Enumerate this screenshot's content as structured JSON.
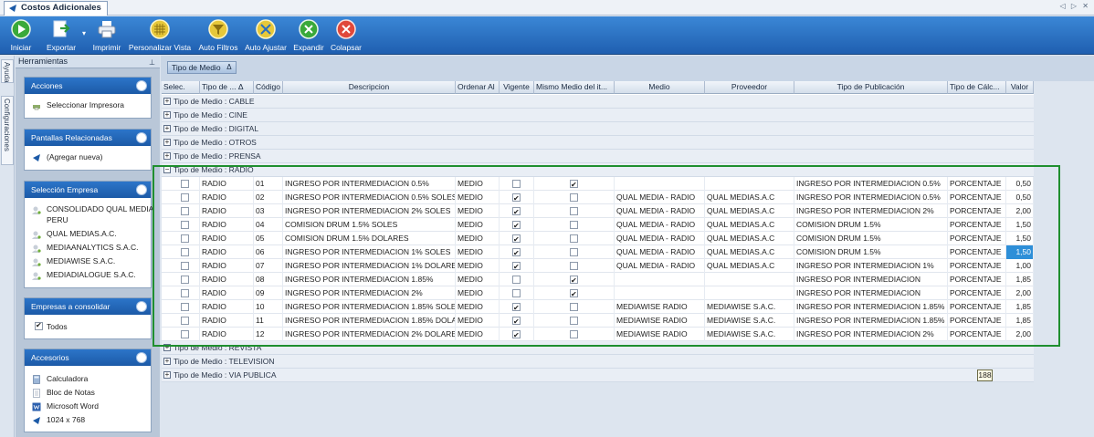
{
  "window": {
    "tab_title": "Costos Adicionales",
    "nav_arrows": "◁ ▷ ✕"
  },
  "toolbar": {
    "buttons": [
      {
        "label": "Iniciar",
        "icon": "play-icon"
      },
      {
        "label": "Exportar",
        "icon": "export-icon"
      },
      {
        "label": "Imprimir",
        "icon": "printer-icon"
      },
      {
        "label": "Personalizar Vista",
        "icon": "grid-view-icon"
      },
      {
        "label": "Auto Filtros",
        "icon": "filter-icon"
      },
      {
        "label": "Auto Ajustar",
        "icon": "auto-fit-icon"
      },
      {
        "label": "Expandir",
        "icon": "expand-icon"
      },
      {
        "label": "Colapsar",
        "icon": "collapse-icon"
      }
    ],
    "export_dropdown": "▾"
  },
  "side_tabs": {
    "ayuda": "Ayuda",
    "configuraciones": "Configuraciones"
  },
  "sidebar": {
    "title": "Herramientas",
    "pin": "⊥",
    "acciones": {
      "title": "Acciones",
      "items": [
        "Seleccionar Impresora"
      ]
    },
    "pantallas": {
      "title": "Pantallas Relacionadas",
      "items": [
        "(Agregar nueva)"
      ]
    },
    "empresa": {
      "title": "Selección Empresa",
      "items": [
        "CONSOLIDADO QUAL MEDIA",
        "PERU",
        "QUAL MEDIAS.A.C.",
        "MEDIAANALYTICS S.A.C.",
        "MEDIAWISE S.A.C.",
        "MEDIADIALOGUE S.A.C."
      ]
    },
    "consolidar": {
      "title": "Empresas a consolidar",
      "items": [
        "Todos"
      ]
    },
    "accesorios": {
      "title": "Accesorios",
      "items": [
        "Calculadora",
        "Bloc de Notas",
        "Microsoft Word",
        "1024 x 768"
      ]
    }
  },
  "grid": {
    "group_chip": "Tipo de Medio",
    "sort_glyph": "Δ",
    "columns": [
      "Selec.",
      "Tipo de ... Δ",
      "Código",
      "Descripcion",
      "Ordenar Al",
      "Vigente",
      "Mismo Medio del it...",
      "Medio",
      "Proveedor",
      "Tipo de Publicación",
      "Tipo de Cálc...",
      "Valor"
    ],
    "groups_before": [
      "Tipo de Medio : CABLE",
      "Tipo de Medio : CINE",
      "Tipo de Medio : DIGITAL",
      "Tipo de Medio : OTROS",
      "Tipo de Medio : PRENSA"
    ],
    "expanded_group": "Tipo de Medio : RADIO",
    "rows": [
      {
        "tipo": "RADIO",
        "codigo": "01",
        "desc": "INGRESO POR INTERMEDIACION 0.5%",
        "ordenar": "MEDIO",
        "vigente": false,
        "mismo": true,
        "medio": "",
        "proveedor": "",
        "publicacion": "INGRESO POR INTERMEDIACION 0.5%",
        "calculo": "PORCENTAJE",
        "valor": "0,50"
      },
      {
        "tipo": "RADIO",
        "codigo": "02",
        "desc": "INGRESO POR INTERMEDIACION 0.5% SOLES",
        "ordenar": "MEDIO",
        "vigente": true,
        "mismo": false,
        "medio": "QUAL MEDIA - RADIO",
        "proveedor": "QUAL MEDIAS.A.C",
        "publicacion": "INGRESO POR INTERMEDIACION 0.5%",
        "calculo": "PORCENTAJE",
        "valor": "0,50"
      },
      {
        "tipo": "RADIO",
        "codigo": "03",
        "desc": "INGRESO POR INTERMEDIACION 2% SOLES",
        "ordenar": "MEDIO",
        "vigente": true,
        "mismo": false,
        "medio": "QUAL MEDIA - RADIO",
        "proveedor": "QUAL MEDIAS.A.C",
        "publicacion": "INGRESO POR INTERMEDIACION 2%",
        "calculo": "PORCENTAJE",
        "valor": "2,00"
      },
      {
        "tipo": "RADIO",
        "codigo": "04",
        "desc": "COMISION DRUM 1.5% SOLES",
        "ordenar": "MEDIO",
        "vigente": true,
        "mismo": false,
        "medio": "QUAL MEDIA - RADIO",
        "proveedor": "QUAL MEDIAS.A.C",
        "publicacion": "COMISION DRUM 1.5%",
        "calculo": "PORCENTAJE",
        "valor": "1,50"
      },
      {
        "tipo": "RADIO",
        "codigo": "05",
        "desc": "COMISION DRUM 1.5% DOLARES",
        "ordenar": "MEDIO",
        "vigente": true,
        "mismo": false,
        "medio": "QUAL MEDIA - RADIO",
        "proveedor": "QUAL MEDIAS.A.C",
        "publicacion": "COMISION DRUM 1.5%",
        "calculo": "PORCENTAJE",
        "valor": "1,50"
      },
      {
        "tipo": "RADIO",
        "codigo": "06",
        "desc": "INGRESO POR INTERMEDIACION 1% SOLES",
        "ordenar": "MEDIO",
        "vigente": true,
        "mismo": false,
        "medio": "QUAL MEDIA - RADIO",
        "proveedor": "QUAL MEDIAS.A.C",
        "publicacion": "COMISION DRUM 1.5%",
        "calculo": "PORCENTAJE",
        "valor": "1,50",
        "selected_value": true
      },
      {
        "tipo": "RADIO",
        "codigo": "07",
        "desc": "INGRESO POR INTERMEDIACION 1% DOLARES",
        "ordenar": "MEDIO",
        "vigente": true,
        "mismo": false,
        "medio": "QUAL MEDIA - RADIO",
        "proveedor": "QUAL MEDIAS.A.C",
        "publicacion": "INGRESO POR INTERMEDIACION 1%",
        "calculo": "PORCENTAJE",
        "valor": "1,00"
      },
      {
        "tipo": "RADIO",
        "codigo": "08",
        "desc": "INGRESO POR INTERMEDIACION 1.85%",
        "ordenar": "MEDIO",
        "vigente": false,
        "mismo": true,
        "medio": "",
        "proveedor": "",
        "publicacion": "INGRESO POR INTERMEDIACION",
        "calculo": "PORCENTAJE",
        "valor": "1,85"
      },
      {
        "tipo": "RADIO",
        "codigo": "09",
        "desc": "INGRESO POR INTERMEDIACION 2%",
        "ordenar": "MEDIO",
        "vigente": false,
        "mismo": true,
        "medio": "",
        "proveedor": "",
        "publicacion": "INGRESO POR INTERMEDIACION",
        "calculo": "PORCENTAJE",
        "valor": "2,00"
      },
      {
        "tipo": "RADIO",
        "codigo": "10",
        "desc": "INGRESO POR INTERMEDIACION 1.85% SOLES",
        "ordenar": "MEDIO",
        "vigente": true,
        "mismo": false,
        "medio": "MEDIAWISE RADIO",
        "proveedor": "MEDIAWISE S.A.C.",
        "publicacion": "INGRESO POR INTERMEDIACION 1.85%",
        "calculo": "PORCENTAJE",
        "valor": "1,85"
      },
      {
        "tipo": "RADIO",
        "codigo": "11",
        "desc": "INGRESO POR INTERMEDIACION 1.85% DOLARES",
        "ordenar": "MEDIO",
        "vigente": true,
        "mismo": false,
        "medio": "MEDIAWISE RADIO",
        "proveedor": "MEDIAWISE S.A.C.",
        "publicacion": "INGRESO POR INTERMEDIACION 1.85%",
        "calculo": "PORCENTAJE",
        "valor": "1,85"
      },
      {
        "tipo": "RADIO",
        "codigo": "12",
        "desc": "INGRESO POR INTERMEDIACION 2% DOLARES",
        "ordenar": "MEDIO",
        "vigente": true,
        "mismo": false,
        "medio": "MEDIAWISE RADIO",
        "proveedor": "MEDIAWISE S.A.C.",
        "publicacion": "INGRESO POR INTERMEDIACION 2%",
        "calculo": "PORCENTAJE",
        "valor": "2,00"
      }
    ],
    "groups_after": [
      "Tipo de Medio : REVISTA",
      "Tipo de Medio : TELEVISION",
      "Tipo de Medio : VIA PUBLICA"
    ],
    "record_count": "188"
  },
  "colors": {
    "toolbar": "#2a70c4",
    "panel_head": "#1f5fb0",
    "highlight_frame": "#1f8f2f",
    "selected_cell": "#2e8fd8"
  }
}
